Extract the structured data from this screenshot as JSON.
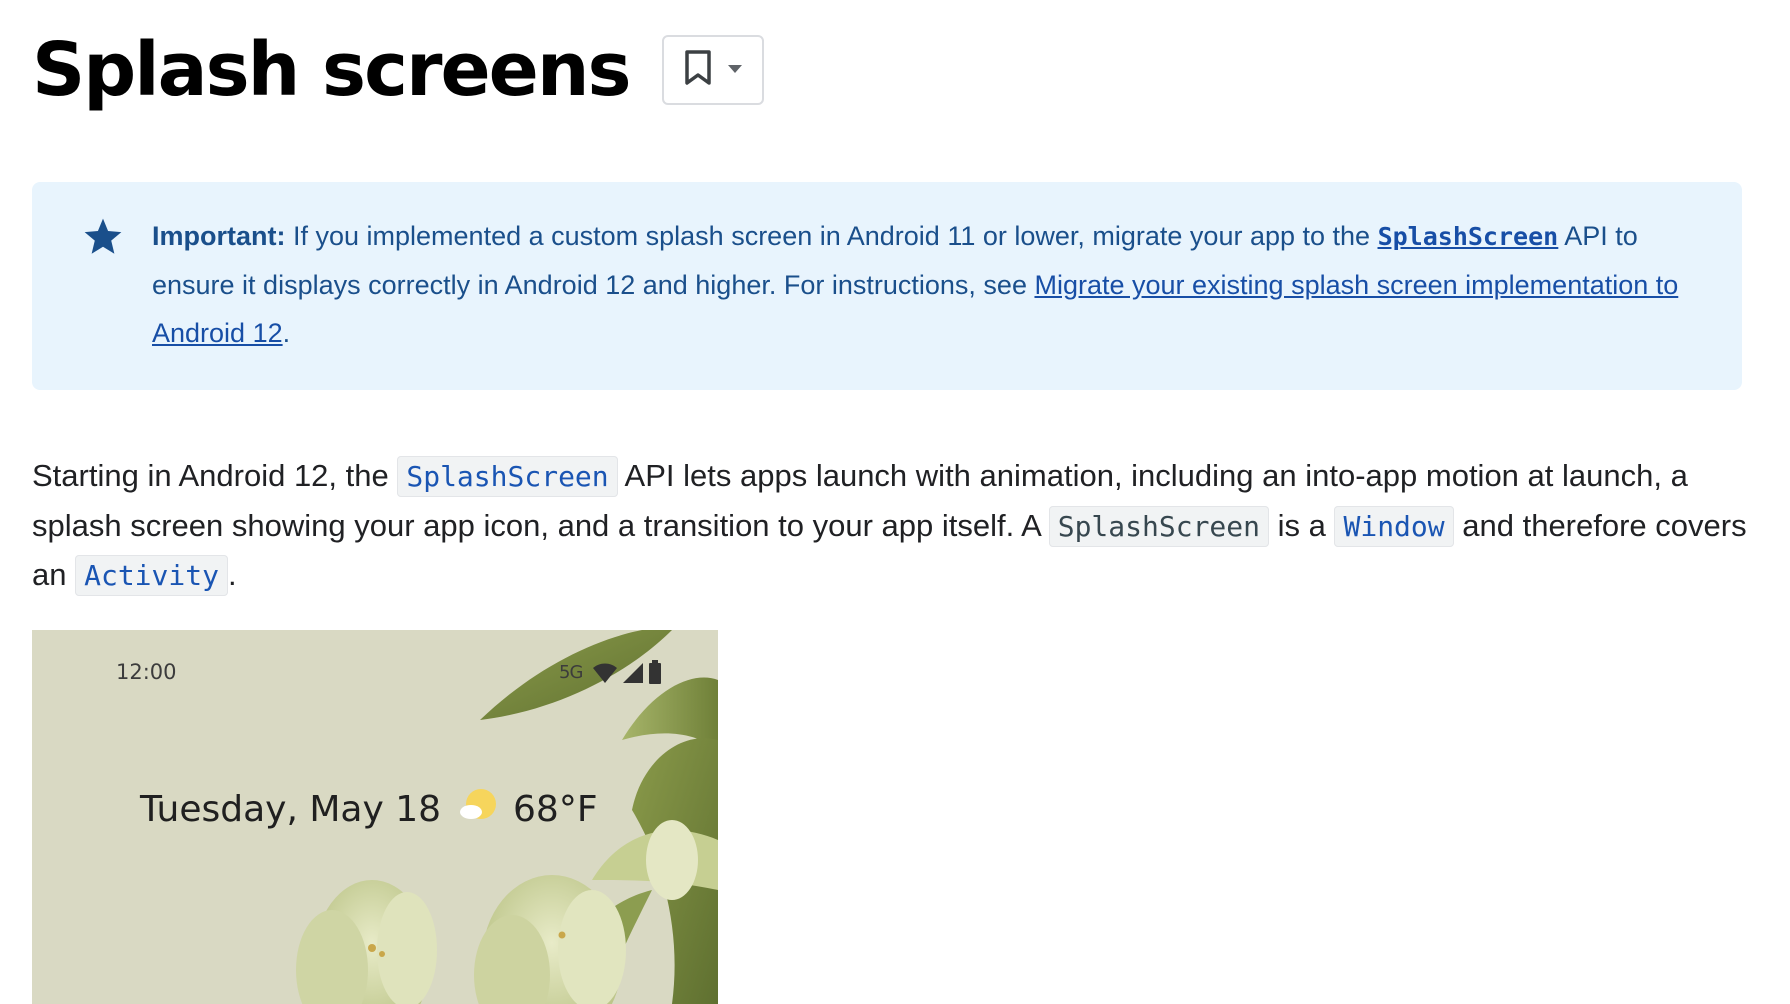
{
  "page": {
    "title": "Splash screens"
  },
  "bookmark": {
    "icon": "bookmark-icon",
    "dropdown_icon": "caret-down-icon"
  },
  "callout": {
    "icon": "star-icon",
    "accent_color": "#1a4f8b",
    "background_color": "#e8f4fd",
    "label": "Important:",
    "text_1": " If you implemented a custom splash screen in Android 11 or lower, migrate your app to the ",
    "api_link": "SplashScreen",
    "text_2": " API to ensure it displays correctly in Android 12 and higher. For instructions, see ",
    "migrate_link": "Migrate your existing splash screen implementation to Android 12",
    "text_3": "."
  },
  "intro": {
    "text_1": "Starting in Android 12, the ",
    "code_1": "SplashScreen",
    "text_2": " API lets apps launch with animation, including an into-app motion at launch, a splash screen showing your app icon, and a transition to your app itself. A ",
    "code_2": "SplashScreen",
    "text_3": " is a ",
    "code_3": "Window",
    "text_4": " and therefore covers an ",
    "code_4": "Activity",
    "text_5": "."
  },
  "phone": {
    "time": "12:00",
    "network": "5G",
    "date": "Tuesday, May 18",
    "temperature": "68°F",
    "icons": [
      "wifi-icon",
      "signal-icon",
      "battery-icon",
      "weather-partly-sunny-icon"
    ]
  }
}
